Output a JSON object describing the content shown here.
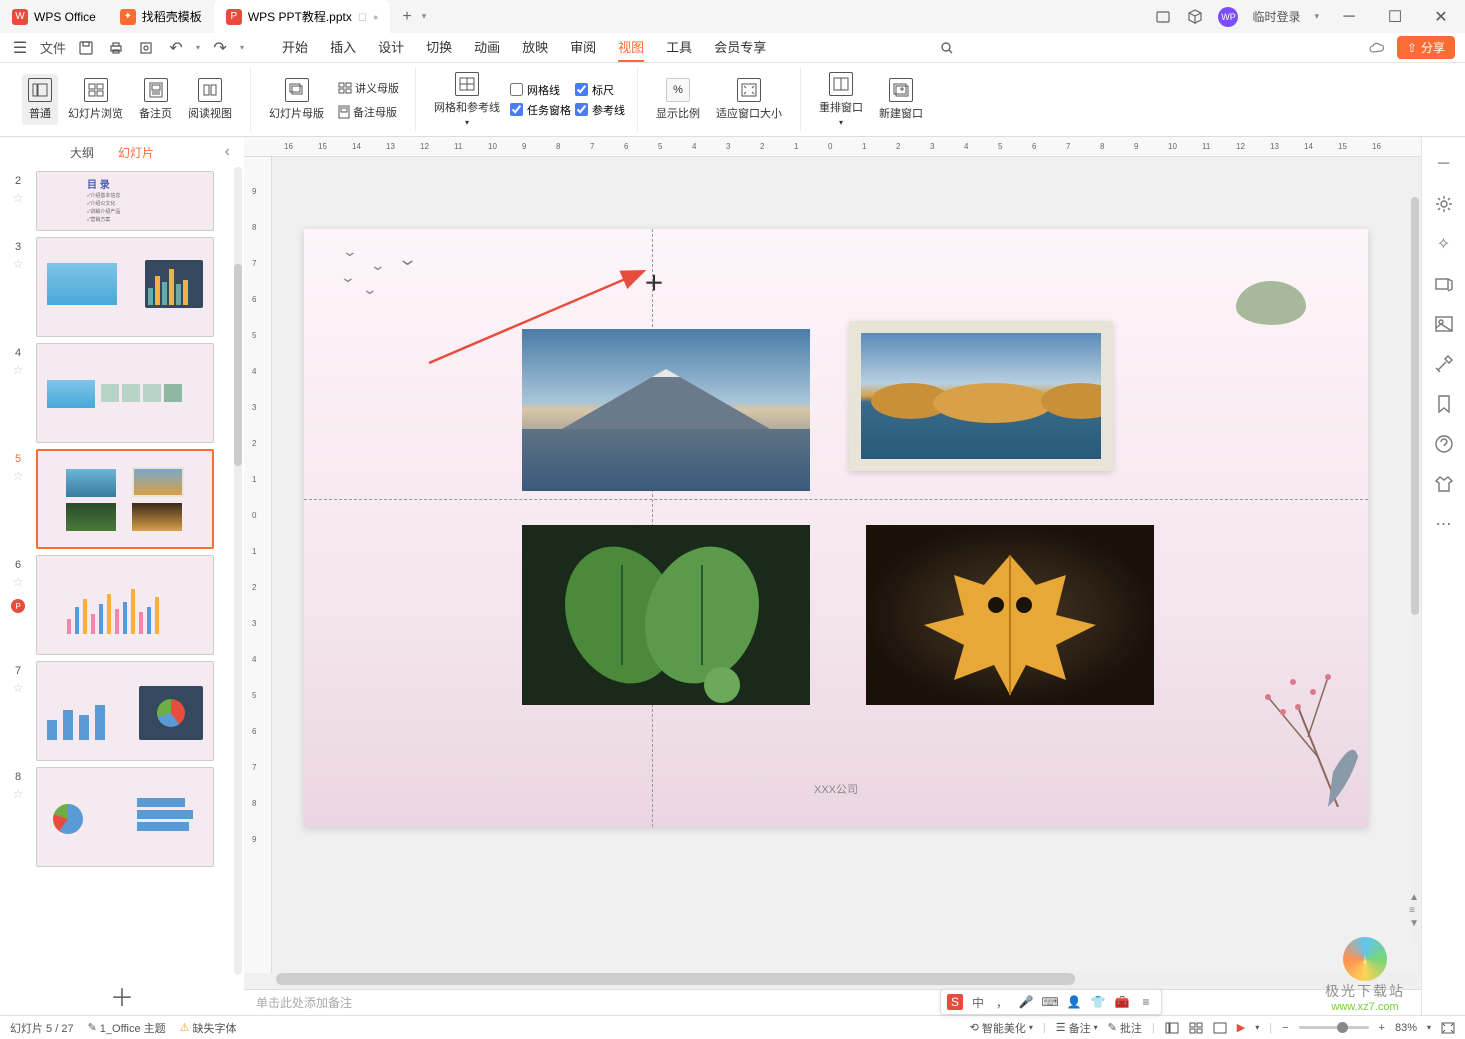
{
  "titlebar": {
    "app_tab": "WPS Office",
    "template_tab": "找稻壳模板",
    "doc_tab": "WPS PPT教程.pptx",
    "new_tab_plus": "+",
    "login": "临时登录"
  },
  "menu": {
    "file": "文件",
    "items": [
      "开始",
      "插入",
      "设计",
      "切换",
      "动画",
      "放映",
      "审阅",
      "视图",
      "工具",
      "会员专享"
    ],
    "active_index": 7,
    "share": "分享"
  },
  "ribbon": {
    "g1": {
      "normal": "普通",
      "browse": "幻灯片浏览",
      "notes": "备注页",
      "read": "阅读视图"
    },
    "g2": {
      "slidemaster": "幻灯片母版",
      "handout": "讲义母版",
      "notesmaster": "备注母版"
    },
    "g3": {
      "gridguides": "网格和参考线",
      "chk_grid": "网格线",
      "chk_ruler": "标尺",
      "chk_taskpane": "任务窗格",
      "chk_guide": "参考线"
    },
    "g4": {
      "zoom": "显示比例",
      "fit": "适应窗口大小"
    },
    "g5": {
      "rearrange": "重排窗口",
      "newwindow": "新建窗口"
    }
  },
  "slidepanel": {
    "tabs": {
      "outline": "大纲",
      "slides": "幻灯片"
    },
    "collapse": "‹",
    "slides": [
      {
        "num": "2"
      },
      {
        "num": "3"
      },
      {
        "num": "4"
      },
      {
        "num": "5"
      },
      {
        "num": "6"
      },
      {
        "num": "7"
      },
      {
        "num": "8"
      }
    ],
    "add": "＋"
  },
  "ruler_h": [
    "16",
    "15",
    "14",
    "13",
    "12",
    "11",
    "10",
    "9",
    "8",
    "7",
    "6",
    "5",
    "4",
    "3",
    "2",
    "1",
    "0",
    "1",
    "2",
    "3",
    "4",
    "5",
    "6",
    "7",
    "8",
    "9",
    "10",
    "11",
    "12",
    "13",
    "14",
    "15",
    "16"
  ],
  "ruler_v": [
    "9",
    "8",
    "7",
    "6",
    "5",
    "4",
    "3",
    "2",
    "1",
    "0",
    "1",
    "2",
    "3",
    "4",
    "5",
    "6",
    "7",
    "8",
    "9"
  ],
  "slide": {
    "company": "XXX公司"
  },
  "notes_placeholder": "单击此处添加备注",
  "statusbar": {
    "slide_pos": "幻灯片 5 / 27",
    "theme": "1_Office 主题",
    "missing_font": "缺失字体",
    "beautify": "智能美化",
    "notes": "备注",
    "comments": "批注",
    "zoom": "83%"
  },
  "floatbar": {
    "ime": "中"
  },
  "watermark": {
    "line1": "极光下载站",
    "line2": "www.xz7.com"
  },
  "colors": {
    "accent": "#ff6b35"
  }
}
